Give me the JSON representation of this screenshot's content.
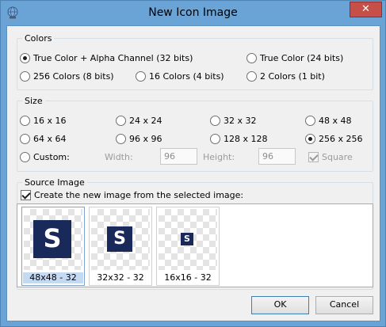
{
  "window": {
    "title": "New Icon Image",
    "close_label": "✕"
  },
  "colors": {
    "legend": "Colors",
    "options": [
      {
        "label": "True Color + Alpha Channel (32 bits)",
        "selected": true
      },
      {
        "label": "True Color (24 bits)",
        "selected": false
      },
      {
        "label": "256 Colors (8 bits)",
        "selected": false
      },
      {
        "label": "16 Colors (4 bits)",
        "selected": false
      },
      {
        "label": "2 Colors (1 bit)",
        "selected": false
      }
    ]
  },
  "size": {
    "legend": "Size",
    "options": [
      {
        "label": "16 x 16",
        "selected": false
      },
      {
        "label": "24 x 24",
        "selected": false
      },
      {
        "label": "32 x 32",
        "selected": false
      },
      {
        "label": "48 x 48",
        "selected": false
      },
      {
        "label": "64 x 64",
        "selected": false
      },
      {
        "label": "96 x 96",
        "selected": false
      },
      {
        "label": "128 x 128",
        "selected": false
      },
      {
        "label": "256 x 256",
        "selected": true
      },
      {
        "label": "Custom:",
        "selected": false
      }
    ],
    "width_label": "Width:",
    "width_value": "96",
    "height_label": "Height:",
    "height_value": "96",
    "square_label": "Square",
    "square_checked": true
  },
  "source": {
    "legend": "Source Image",
    "create_label": "Create the new image from the selected image:",
    "create_checked": true,
    "icon_letter": "S",
    "images": [
      {
        "label": "48x48 - 32",
        "selected": true
      },
      {
        "label": "32x32 - 32",
        "selected": false
      },
      {
        "label": "16x16 - 32",
        "selected": false
      }
    ]
  },
  "buttons": {
    "ok": "OK",
    "cancel": "Cancel"
  },
  "icon_color": "#18295a"
}
